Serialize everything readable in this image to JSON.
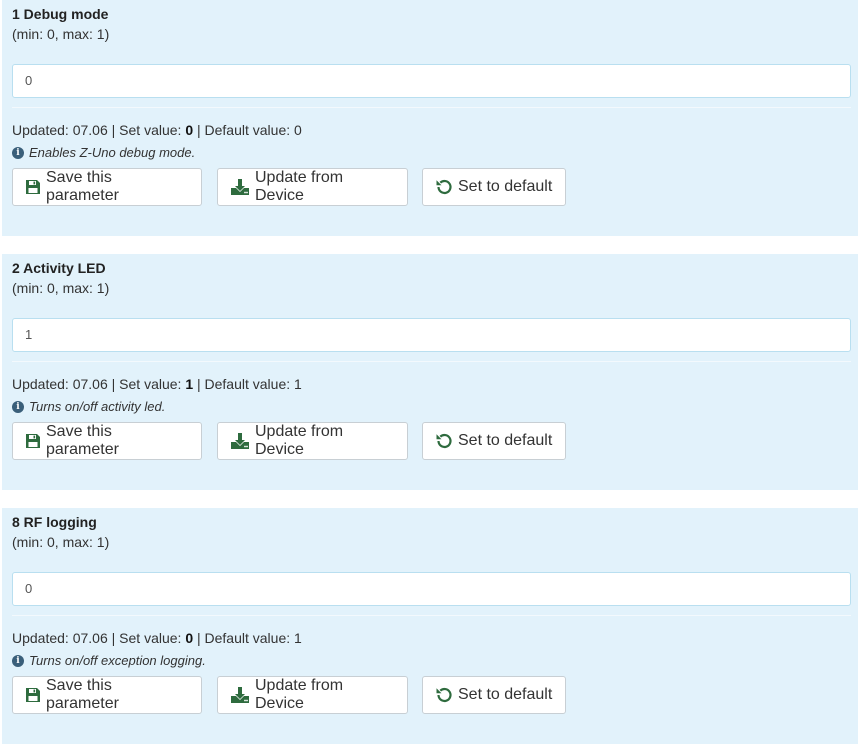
{
  "labels": {
    "save": "Save this parameter",
    "update": "Update from Device",
    "default": "Set to default"
  },
  "colors": {
    "panel_bg": "#e2f2fb",
    "icon_green": "#2e6b3e",
    "info_icon": "#3a5f7a"
  },
  "parameters": [
    {
      "title": "1 Debug mode",
      "range": "(min: 0, max: 1)",
      "value": "0",
      "updated_label": "Updated: 07.06 | Set value: ",
      "set_value": "0",
      "default_label": " | Default value: 0",
      "info": "Enables Z-Uno debug mode."
    },
    {
      "title": "2 Activity LED",
      "range": "(min: 0, max: 1)",
      "value": "1",
      "updated_label": "Updated: 07.06 | Set value: ",
      "set_value": "1",
      "default_label": " | Default value: 1",
      "info": "Turns on/off activity led."
    },
    {
      "title": "8 RF logging",
      "range": "(min: 0, max: 1)",
      "value": "0",
      "updated_label": "Updated: 07.06 | Set value: ",
      "set_value": "0",
      "default_label": " | Default value: 1",
      "info": "Turns on/off exception logging."
    }
  ]
}
